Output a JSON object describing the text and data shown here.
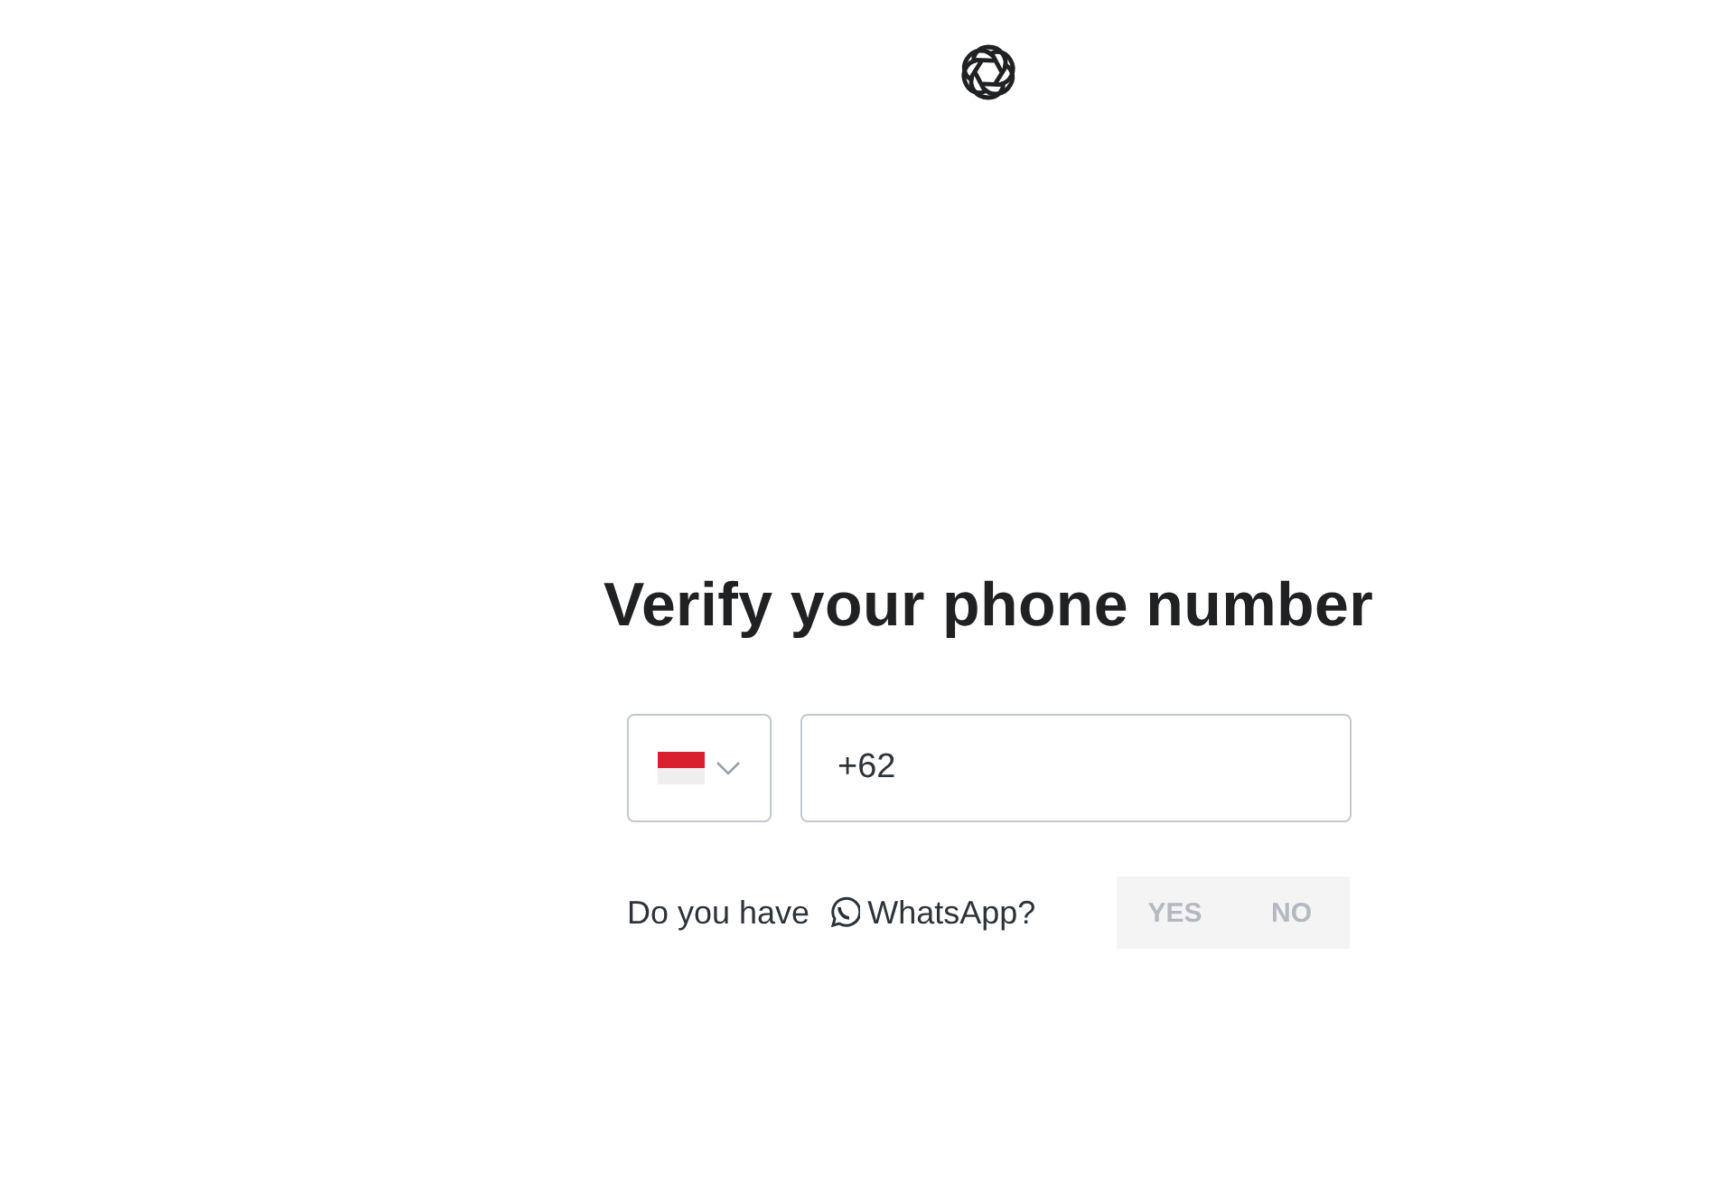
{
  "title": "Verify your phone number",
  "phone": {
    "value": "+62"
  },
  "whatsapp": {
    "prefix": "Do you have",
    "label": "WhatsApp?"
  },
  "options": [
    {
      "label": "YES",
      "selected": false
    },
    {
      "label": "NO",
      "selected": false
    }
  ]
}
